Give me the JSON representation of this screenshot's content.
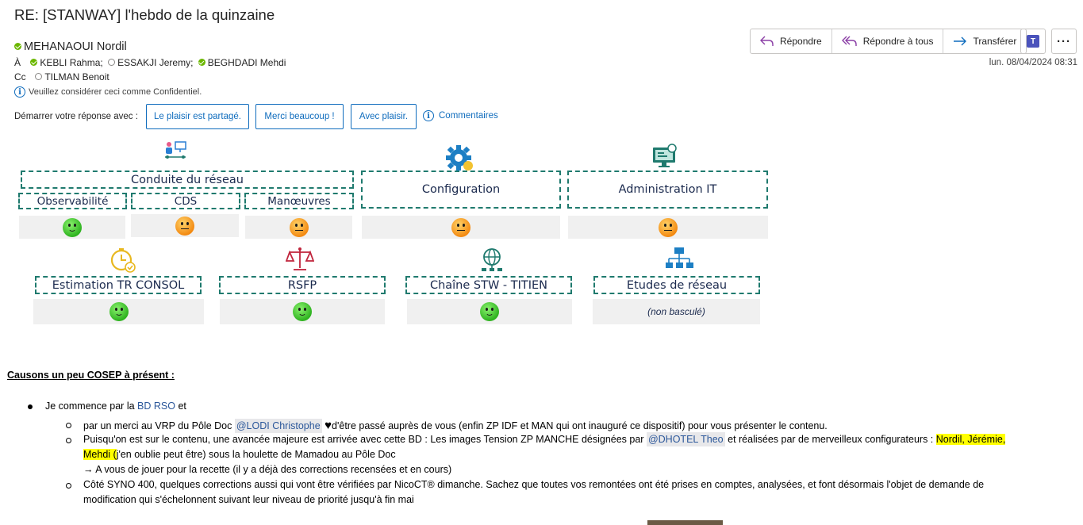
{
  "subject": "RE: [STANWAY] l'hebdo de la quinzaine",
  "sender": "MEHANAOUI Nordil",
  "to": {
    "label": "À",
    "recipients": [
      {
        "name": "KEBLI Rahma;",
        "status": "available"
      },
      {
        "name": "ESSAKJI Jeremy;",
        "status": "offline"
      },
      {
        "name": "BEGHDADI Mehdi",
        "status": "available"
      }
    ]
  },
  "cc": {
    "label": "Cc",
    "recipients": [
      {
        "name": "TILMAN Benoit",
        "status": "offline"
      }
    ]
  },
  "confidential": "Veuillez considérer ceci comme Confidentiel.",
  "actions": {
    "reply": "Répondre",
    "reply_all": "Répondre à tous",
    "forward": "Transférer",
    "more": "···"
  },
  "date": "lun. 08/04/2024 08:31",
  "quick_reply": {
    "label": "Démarrer votre réponse avec :",
    "options": [
      "Le plaisir est partagé.",
      "Merci beaucoup !",
      "Avec plaisir."
    ],
    "comments": "Commentaires"
  },
  "dashboard": {
    "group_title": "Conduite du réseau",
    "row1": [
      {
        "label": "Observabilité",
        "status": "happy"
      },
      {
        "label": "CDS",
        "status": "neutral"
      },
      {
        "label": "Manœuvres",
        "status": "neutral"
      },
      {
        "label": "Configuration",
        "status": "neutral"
      },
      {
        "label": "Administration IT",
        "status": "neutral"
      }
    ],
    "row2": [
      {
        "label": "Estimation TR CONSOL",
        "status": "happy"
      },
      {
        "label": "RSFP",
        "status": "happy"
      },
      {
        "label": "Chaîne STW - TITIEN",
        "status": "happy"
      },
      {
        "label": "Etudes de réseau",
        "status": "(non basculé)"
      }
    ]
  },
  "body": {
    "heading": "Causons un peu COSEP à présent :",
    "bullet1_prefix": "Je commence par la",
    "bullet1_link": "BD RSO",
    "bullet1_suffix": "et",
    "sub1_a": "par un merci au VRP du Pôle Doc",
    "sub1_mention": "@LODI Christophe",
    "sub1_heart": "♥",
    "sub1_b": "d'être passé auprès de vous (enfin ZP IDF et MAN qui ont inauguré ce dispositif) pour vous présenter le contenu.",
    "sub2_a": "Puisqu'on est sur le contenu, une avancée majeure est arrivée avec cette BD : Les images Tension ZP MANCHE désignées par",
    "sub2_mention": "@DHOTEL Theo",
    "sub2_b": "et réalisées par de merveilleux configurateurs :",
    "sub2_hl1": "Nordil, Jérémie,",
    "sub2_hl2": "Mehdi (",
    "sub2_c": "j'en oublie peut être) sous la houlette de Mamadou au Pôle Doc",
    "sub2_arrow": "→",
    "sub2_d": "A vous de jouer pour la recette (il y a déjà des corrections recensées et en cours)",
    "sub3_a": "Côté SYNO 400, quelques corrections aussi qui vont être vérifiées par NicoCT® dimanche. Sachez que toutes vos remontées ont été prises en comptes, analysées, et font désormais l'objet de demande de",
    "sub3_b": "modification qui s'échelonnent suivant leur niveau de priorité jusqu'à fin mai"
  },
  "colors": {
    "accent": "#0f6cbd",
    "dash_border": "#1f7a6e",
    "highlight": "#ffff00",
    "happy": "#2fb320",
    "neutral": "#f38a12"
  }
}
